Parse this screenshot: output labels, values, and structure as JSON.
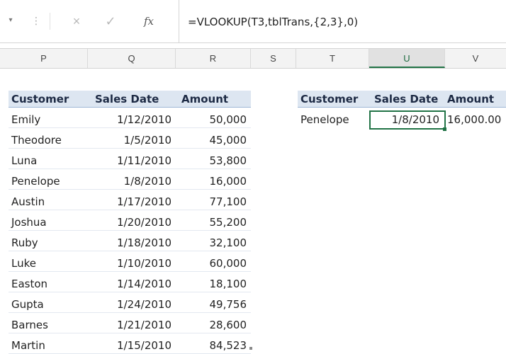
{
  "formula_bar": {
    "formula": "=VLOOKUP(T3,tblTrans,{2,3},0)",
    "fx_label": "fx",
    "cancel_glyph": "×",
    "enter_glyph": "✓",
    "namebox_arrow": "▾",
    "dots": "⋮"
  },
  "columns": [
    "P",
    "Q",
    "R",
    "S",
    "T",
    "U",
    "V"
  ],
  "selected_column": "U",
  "table": {
    "headers": [
      "Customer",
      "Sales Date",
      "Amount"
    ],
    "rows": [
      [
        "Emily",
        "1/12/2010",
        "50,000"
      ],
      [
        "Theodore",
        "1/5/2010",
        "45,000"
      ],
      [
        "Luna",
        "1/11/2010",
        "53,800"
      ],
      [
        "Penelope",
        "1/8/2010",
        "16,000"
      ],
      [
        "Austin",
        "1/17/2010",
        "77,100"
      ],
      [
        "Joshua",
        "1/20/2010",
        "55,200"
      ],
      [
        "Ruby",
        "1/18/2010",
        "32,100"
      ],
      [
        "Luke",
        "1/10/2010",
        "60,000"
      ],
      [
        "Easton",
        "1/14/2010",
        "18,100"
      ],
      [
        "Gupta",
        "1/24/2010",
        "49,756"
      ],
      [
        "Barnes",
        "1/21/2010",
        "28,600"
      ],
      [
        "Martin",
        "1/15/2010",
        "84,523"
      ]
    ]
  },
  "lookup": {
    "headers": [
      "Customer",
      "Sales Date",
      "Amount"
    ],
    "row": [
      "Penelope",
      "1/8/2010",
      "16,000.00"
    ]
  },
  "colors": {
    "header_fill": "#dde6f1",
    "selection_green": "#217346"
  }
}
